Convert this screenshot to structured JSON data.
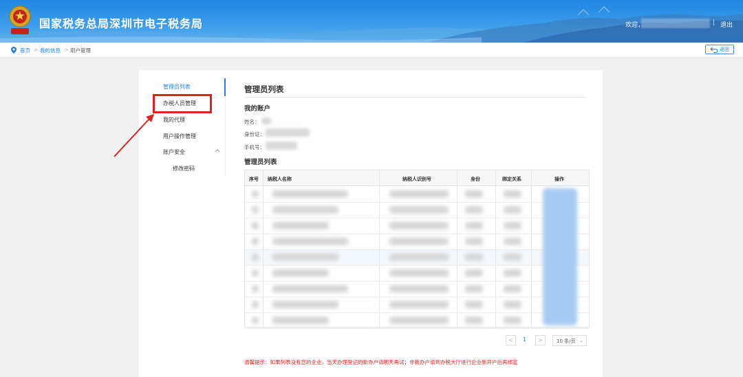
{
  "header": {
    "site_title": "国家税务总局深圳市电子税务局",
    "welcome": "欢迎，",
    "separator": "|",
    "logout": "退出",
    "emblem_text": "中国税务"
  },
  "breadcrumb": {
    "items": [
      "首页",
      "我的信息",
      "用户管理"
    ],
    "arrow": ">",
    "back_label": "返回"
  },
  "sidebar": {
    "items": [
      {
        "label": "管理员列表",
        "active": true
      },
      {
        "label": "办税人员管理"
      },
      {
        "label": "我的代理"
      },
      {
        "label": "用户操作管理"
      },
      {
        "label": "账户安全"
      },
      {
        "label": "修改密码"
      }
    ]
  },
  "main": {
    "title": "管理员列表",
    "account_section": "我的账户",
    "fields": [
      {
        "label": "姓名："
      },
      {
        "label": "身份证："
      },
      {
        "label": "手机号："
      }
    ],
    "list_section": "管理员列表",
    "table": {
      "columns": [
        "序号",
        "纳税人名称",
        "纳税人识别号",
        "身份",
        "绑定关系",
        "操作"
      ],
      "row_count": 9
    },
    "pager": {
      "prev": "<",
      "page": "1",
      "next": ">",
      "page_size": "10 条/页"
    },
    "tip": "温馨提示：如果列表没有您的企业，当天办理登记的新办户请明天再试；非新办户请到办税大厅进行企业新开户后再绑定"
  },
  "colors": {
    "header_blue": "#1f86df",
    "link_blue": "#2a7fd4",
    "highlight_red": "#e0201b"
  }
}
